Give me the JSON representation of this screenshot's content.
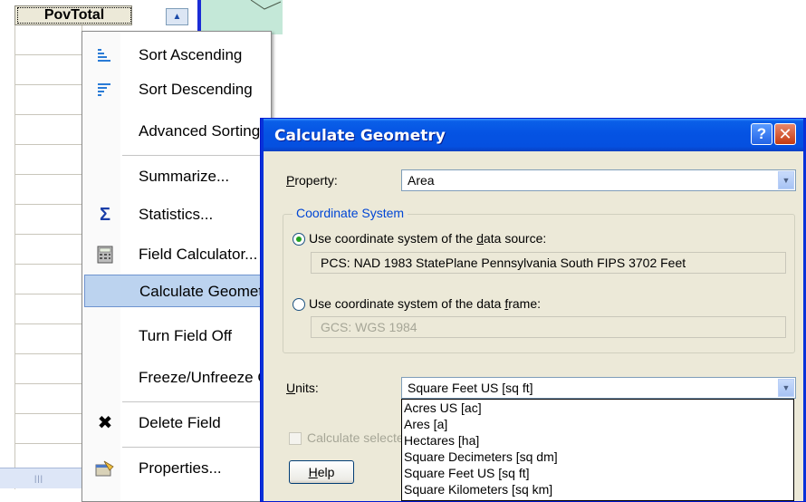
{
  "table": {
    "column_header": "PovTotal"
  },
  "context_menu": {
    "items": [
      {
        "label": "Sort Ascending",
        "icon": "sort-ascending-icon"
      },
      {
        "label": "Sort Descending",
        "icon": "sort-descending-icon"
      },
      {
        "label": "Advanced Sorting...",
        "icon": ""
      },
      {
        "label": "Summarize...",
        "icon": ""
      },
      {
        "label": "Statistics...",
        "icon": "sigma-icon"
      },
      {
        "label": "Field Calculator...",
        "icon": "calculator-icon"
      },
      {
        "label": "Calculate Geometry...",
        "icon": "",
        "selected": true
      },
      {
        "label": "Turn Field Off",
        "icon": ""
      },
      {
        "label": "Freeze/Unfreeze Column",
        "icon": ""
      },
      {
        "label": "Delete Field",
        "icon": "delete-x-icon"
      },
      {
        "label": "Properties...",
        "icon": "properties-icon"
      }
    ]
  },
  "dialog": {
    "title": "Calculate Geometry",
    "property_label": "Property:",
    "property_value": "Area",
    "coordinate_group_label": "Coordinate System",
    "radio_source_label": "Use coordinate system of the data source:",
    "radio_source_selected": true,
    "source_coordinate_system": "PCS: NAD 1983 StatePlane Pennsylvania South FIPS 3702 Feet",
    "radio_frame_label": "Use coordinate system of the data frame:",
    "frame_coordinate_system": "GCS: WGS 1984",
    "units_label": "Units:",
    "units_value": "Square Feet US [sq ft]",
    "units_options": [
      "Acres US [ac]",
      "Ares [a]",
      "Hectares [ha]",
      "Square Decimeters [sq dm]",
      "Square Feet US [sq ft]",
      "Square Kilometers [sq km]"
    ],
    "calculate_selected_label": "Calculate selected records only",
    "help_button": "Help"
  },
  "colors": {
    "title_bar": "#0553e3",
    "selection": "#bcd3ef",
    "group_label": "#0046d5"
  }
}
